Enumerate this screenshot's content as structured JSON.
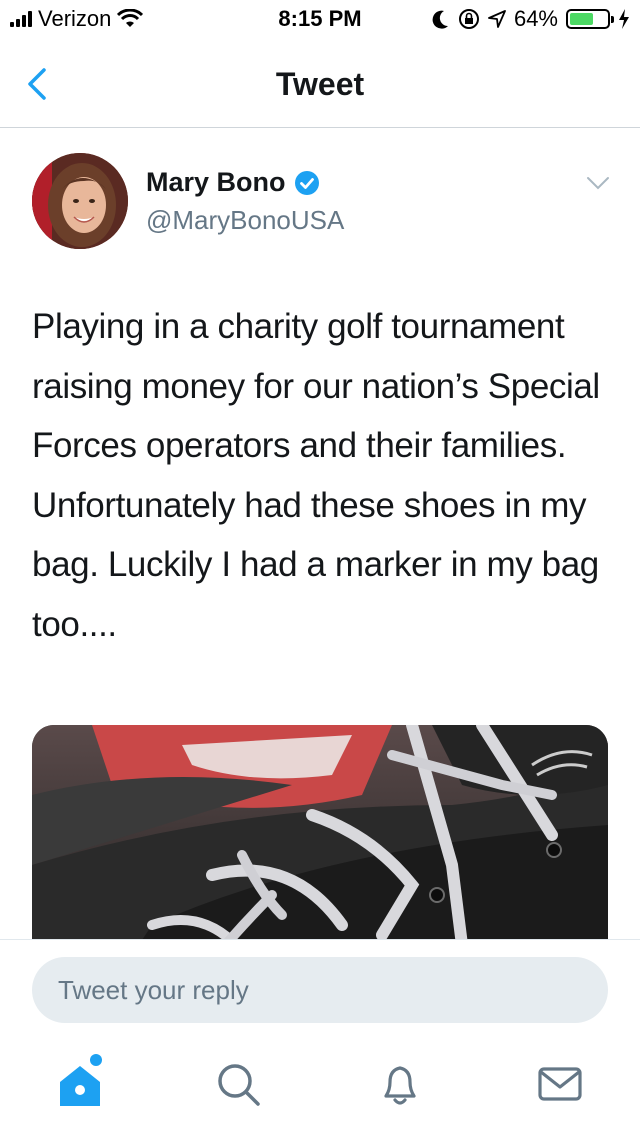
{
  "status_bar": {
    "carrier": "Verizon",
    "time": "8:15 PM",
    "battery_percent": "64%",
    "battery_level": 0.64
  },
  "nav": {
    "title": "Tweet"
  },
  "tweet": {
    "author_name": "Mary Bono",
    "handle": "@MaryBonoUSA",
    "verified": true,
    "text": "Playing in a charity golf tournament raising money for our nation’s Special Forces operators and their families. Unfortunately had these shoes in my bag. Luckily I had a marker in my bag too...."
  },
  "reply": {
    "placeholder": "Tweet your reply"
  },
  "tabs": [
    {
      "name": "home",
      "icon": "home-icon",
      "active": true
    },
    {
      "name": "search",
      "icon": "search-icon"
    },
    {
      "name": "notifications",
      "icon": "bell-icon"
    },
    {
      "name": "messages",
      "icon": "envelope-icon"
    }
  ],
  "colors": {
    "accent": "#1da1f2",
    "secondary_text": "#657786",
    "divider": "#cfd5da"
  }
}
